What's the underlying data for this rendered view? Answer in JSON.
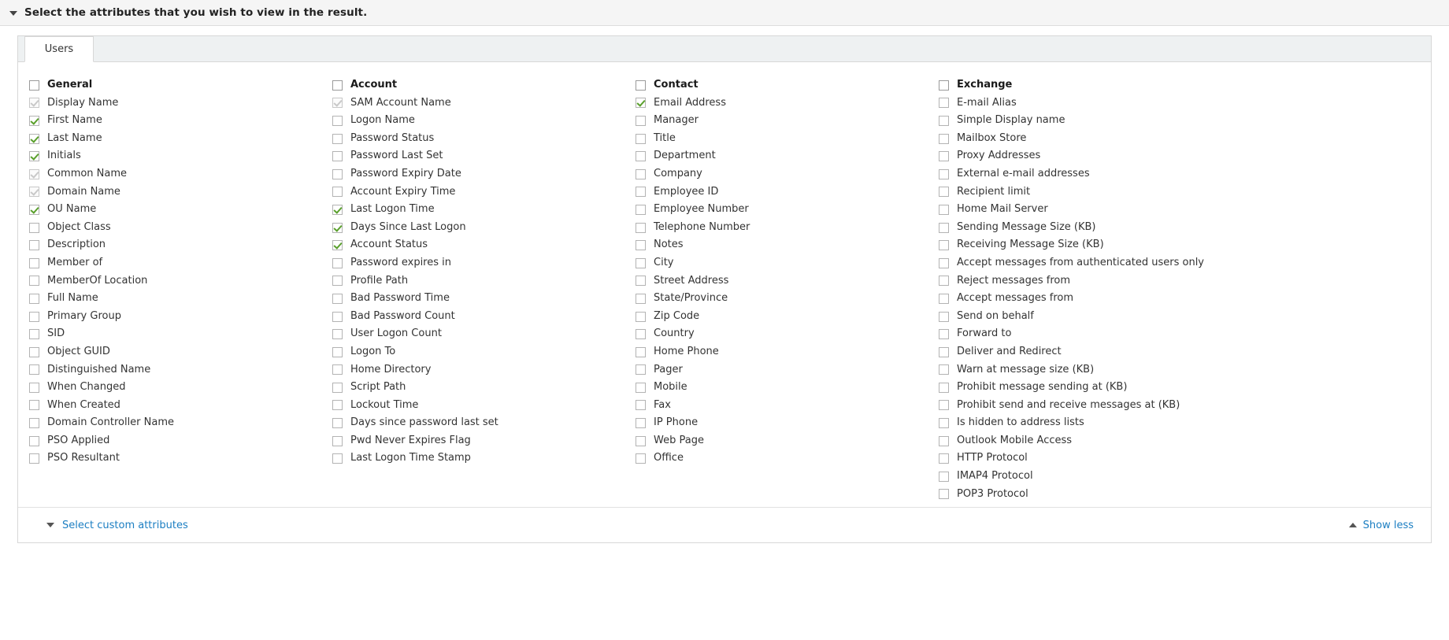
{
  "header": {
    "title": "Select the attributes that you wish to view in the result.",
    "toggle_icon": "caret-down-icon"
  },
  "tabs": [
    {
      "label": "Users",
      "active": true
    }
  ],
  "columns": [
    {
      "group": {
        "label": "General",
        "state": "unchecked"
      },
      "items": [
        {
          "label": "Display Name",
          "state": "checked-disabled"
        },
        {
          "label": "First Name",
          "state": "checked"
        },
        {
          "label": "Last Name",
          "state": "checked"
        },
        {
          "label": "Initials",
          "state": "checked"
        },
        {
          "label": "Common Name",
          "state": "checked-disabled"
        },
        {
          "label": "Domain Name",
          "state": "checked-disabled"
        },
        {
          "label": "OU Name",
          "state": "checked"
        },
        {
          "label": "Object Class",
          "state": "unchecked"
        },
        {
          "label": "Description",
          "state": "unchecked"
        },
        {
          "label": "Member of",
          "state": "unchecked"
        },
        {
          "label": "MemberOf Location",
          "state": "unchecked"
        },
        {
          "label": "Full Name",
          "state": "unchecked"
        },
        {
          "label": "Primary Group",
          "state": "unchecked"
        },
        {
          "label": "SID",
          "state": "unchecked"
        },
        {
          "label": "Object GUID",
          "state": "unchecked"
        },
        {
          "label": "Distinguished Name",
          "state": "unchecked"
        },
        {
          "label": "When Changed",
          "state": "unchecked"
        },
        {
          "label": "When Created",
          "state": "unchecked"
        },
        {
          "label": "Domain Controller Name",
          "state": "unchecked"
        },
        {
          "label": "PSO Applied",
          "state": "unchecked"
        },
        {
          "label": "PSO Resultant",
          "state": "unchecked"
        }
      ]
    },
    {
      "group": {
        "label": "Account",
        "state": "unchecked"
      },
      "items": [
        {
          "label": "SAM Account Name",
          "state": "checked-disabled"
        },
        {
          "label": "Logon Name",
          "state": "unchecked"
        },
        {
          "label": "Password Status",
          "state": "unchecked"
        },
        {
          "label": "Password Last Set",
          "state": "unchecked"
        },
        {
          "label": "Password Expiry Date",
          "state": "unchecked"
        },
        {
          "label": "Account Expiry Time",
          "state": "unchecked"
        },
        {
          "label": "Last Logon Time",
          "state": "checked"
        },
        {
          "label": "Days Since Last Logon",
          "state": "checked"
        },
        {
          "label": "Account Status",
          "state": "checked"
        },
        {
          "label": "Password expires in",
          "state": "unchecked"
        },
        {
          "label": "Profile Path",
          "state": "unchecked"
        },
        {
          "label": "Bad Password Time",
          "state": "unchecked"
        },
        {
          "label": "Bad Password Count",
          "state": "unchecked"
        },
        {
          "label": "User Logon Count",
          "state": "unchecked"
        },
        {
          "label": "Logon To",
          "state": "unchecked"
        },
        {
          "label": "Home Directory",
          "state": "unchecked"
        },
        {
          "label": "Script Path",
          "state": "unchecked"
        },
        {
          "label": "Lockout Time",
          "state": "unchecked"
        },
        {
          "label": "Days since password last set",
          "state": "unchecked"
        },
        {
          "label": "Pwd Never Expires Flag",
          "state": "unchecked"
        },
        {
          "label": "Last Logon Time Stamp",
          "state": "unchecked"
        }
      ]
    },
    {
      "group": {
        "label": "Contact",
        "state": "unchecked"
      },
      "items": [
        {
          "label": "Email Address",
          "state": "checked"
        },
        {
          "label": "Manager",
          "state": "unchecked"
        },
        {
          "label": "Title",
          "state": "unchecked"
        },
        {
          "label": "Department",
          "state": "unchecked"
        },
        {
          "label": "Company",
          "state": "unchecked"
        },
        {
          "label": "Employee ID",
          "state": "unchecked"
        },
        {
          "label": "Employee Number",
          "state": "unchecked"
        },
        {
          "label": "Telephone Number",
          "state": "unchecked"
        },
        {
          "label": "Notes",
          "state": "unchecked"
        },
        {
          "label": "City",
          "state": "unchecked"
        },
        {
          "label": "Street Address",
          "state": "unchecked"
        },
        {
          "label": "State/Province",
          "state": "unchecked"
        },
        {
          "label": "Zip Code",
          "state": "unchecked"
        },
        {
          "label": "Country",
          "state": "unchecked"
        },
        {
          "label": "Home Phone",
          "state": "unchecked"
        },
        {
          "label": "Pager",
          "state": "unchecked"
        },
        {
          "label": "Mobile",
          "state": "unchecked"
        },
        {
          "label": "Fax",
          "state": "unchecked"
        },
        {
          "label": "IP Phone",
          "state": "unchecked"
        },
        {
          "label": "Web Page",
          "state": "unchecked"
        },
        {
          "label": "Office",
          "state": "unchecked"
        }
      ]
    },
    {
      "group": {
        "label": "Exchange",
        "state": "unchecked"
      },
      "items": [
        {
          "label": "E-mail Alias",
          "state": "unchecked"
        },
        {
          "label": "Simple Display name",
          "state": "unchecked"
        },
        {
          "label": "Mailbox Store",
          "state": "unchecked"
        },
        {
          "label": "Proxy Addresses",
          "state": "unchecked"
        },
        {
          "label": "External e-mail addresses",
          "state": "unchecked"
        },
        {
          "label": "Recipient limit",
          "state": "unchecked"
        },
        {
          "label": "Home Mail Server",
          "state": "unchecked"
        },
        {
          "label": "Sending Message Size (KB)",
          "state": "unchecked"
        },
        {
          "label": "Receiving Message Size (KB)",
          "state": "unchecked"
        },
        {
          "label": "Accept messages from authenticated users only",
          "state": "unchecked"
        },
        {
          "label": "Reject messages from",
          "state": "unchecked"
        },
        {
          "label": "Accept messages from",
          "state": "unchecked"
        },
        {
          "label": "Send on behalf",
          "state": "unchecked"
        },
        {
          "label": "Forward to",
          "state": "unchecked"
        },
        {
          "label": "Deliver and Redirect",
          "state": "unchecked"
        },
        {
          "label": "Warn at message size (KB)",
          "state": "unchecked"
        },
        {
          "label": "Prohibit message sending at (KB)",
          "state": "unchecked"
        },
        {
          "label": "Prohibit send and receive messages at (KB)",
          "state": "unchecked"
        },
        {
          "label": "Is hidden to address lists",
          "state": "unchecked"
        },
        {
          "label": "Outlook Mobile Access",
          "state": "unchecked"
        },
        {
          "label": "HTTP Protocol",
          "state": "unchecked"
        },
        {
          "label": "IMAP4 Protocol",
          "state": "unchecked"
        },
        {
          "label": "POP3 Protocol",
          "state": "unchecked"
        }
      ]
    }
  ],
  "footer": {
    "custom_attributes_label": "Select custom attributes",
    "custom_attributes_icon": "caret-down-icon",
    "show_less_label": "Show less",
    "show_less_icon": "caret-up-icon"
  },
  "colors": {
    "link": "#1b7ec2",
    "check_green": "#5aa02c",
    "check_disabled": "#c9c9c9",
    "header_bg": "#f5f5f5",
    "tabstrip_bg": "#eef1f2",
    "border": "#d7d7d7"
  }
}
